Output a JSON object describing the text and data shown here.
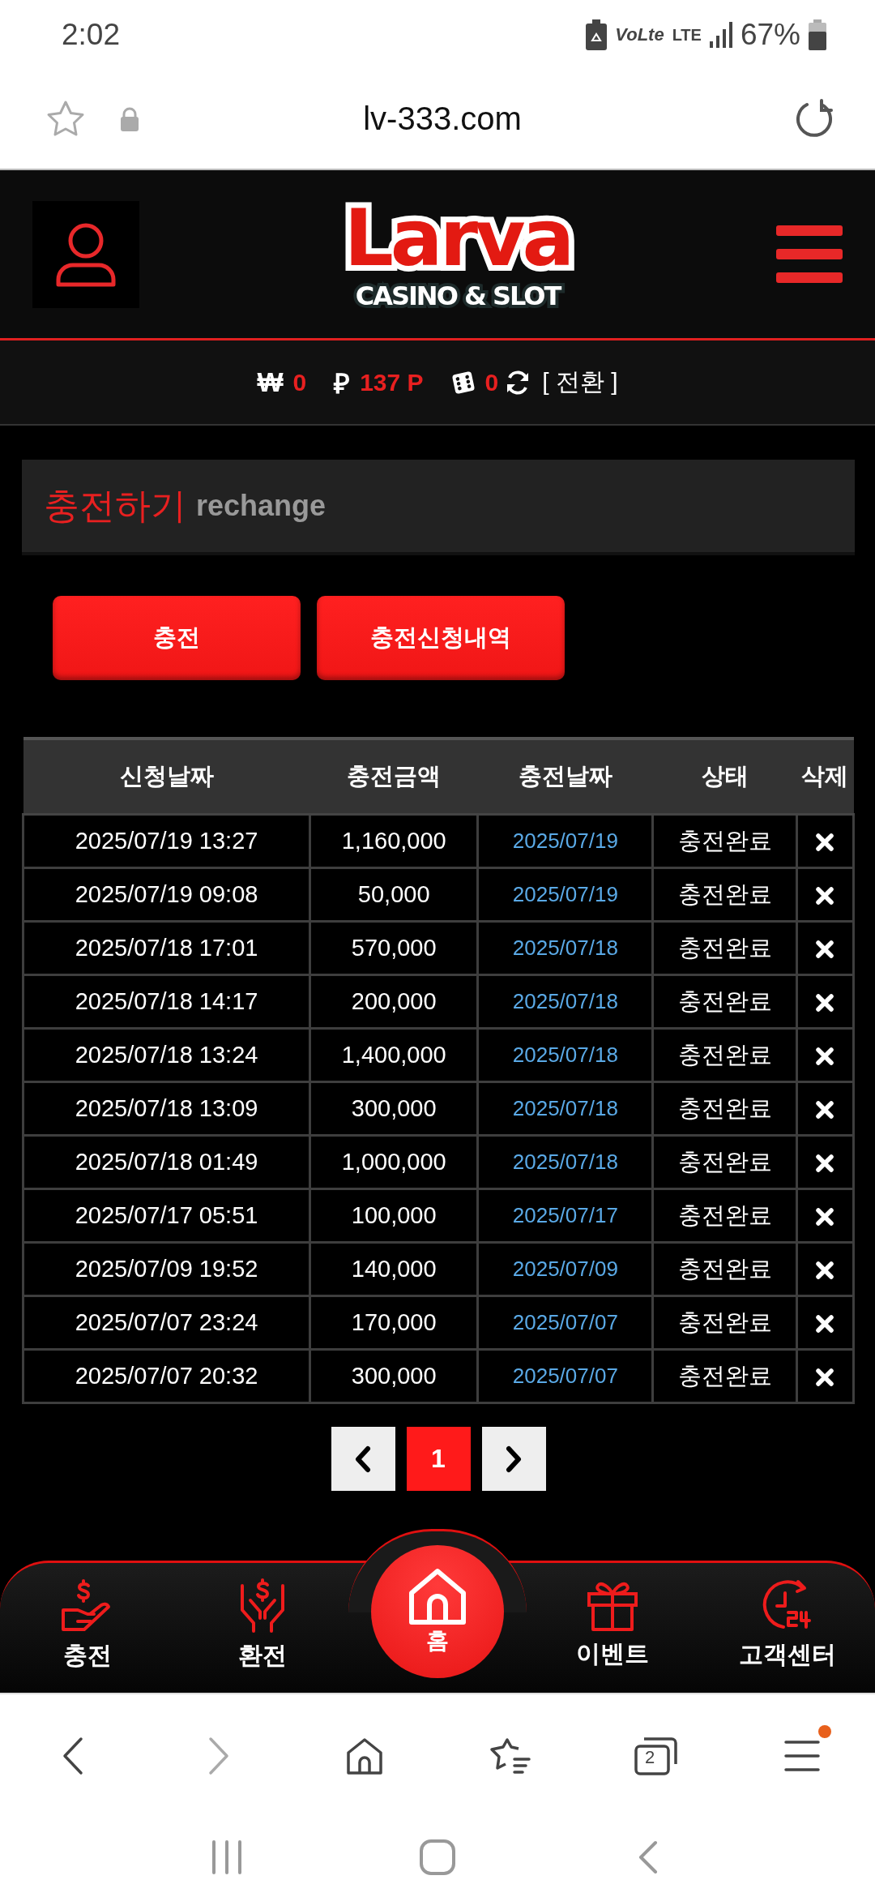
{
  "status_bar": {
    "time": "2:02",
    "volte": "VoLte",
    "network": "LTE",
    "battery": "67%"
  },
  "browser": {
    "url": "lv-333.com",
    "tabs_count": "2",
    "menu_badge": true
  },
  "logo": {
    "title": "Larva",
    "subtitle": "CASINO & SLOT"
  },
  "balance": [
    {
      "symbol": "₩",
      "kind": "won",
      "value": "0"
    },
    {
      "symbol": "₽",
      "kind": "point",
      "value": "137 P"
    },
    {
      "kind": "dice",
      "value": "0"
    }
  ],
  "convert_link": "[ 전환 ]",
  "page_title": {
    "korean": "충전하기",
    "english": "rechange"
  },
  "buttons": [
    {
      "label": "충전"
    },
    {
      "label": "충전신청내역"
    }
  ],
  "table": {
    "columns": [
      "신청날짜",
      "충전금액",
      "충전날짜",
      "상태",
      "삭제"
    ],
    "rows": [
      {
        "requested": "2025/07/19 13:27",
        "amount": "1,160,000",
        "charged": "2025/07/19",
        "status": "충전완료"
      },
      {
        "requested": "2025/07/19 09:08",
        "amount": "50,000",
        "charged": "2025/07/19",
        "status": "충전완료"
      },
      {
        "requested": "2025/07/18 17:01",
        "amount": "570,000",
        "charged": "2025/07/18",
        "status": "충전완료"
      },
      {
        "requested": "2025/07/18 14:17",
        "amount": "200,000",
        "charged": "2025/07/18",
        "status": "충전완료"
      },
      {
        "requested": "2025/07/18 13:24",
        "amount": "1,400,000",
        "charged": "2025/07/18",
        "status": "충전완료"
      },
      {
        "requested": "2025/07/18 13:09",
        "amount": "300,000",
        "charged": "2025/07/18",
        "status": "충전완료"
      },
      {
        "requested": "2025/07/18 01:49",
        "amount": "1,000,000",
        "charged": "2025/07/18",
        "status": "충전완료"
      },
      {
        "requested": "2025/07/17 05:51",
        "amount": "100,000",
        "charged": "2025/07/17",
        "status": "충전완료"
      },
      {
        "requested": "2025/07/09 19:52",
        "amount": "140,000",
        "charged": "2025/07/09",
        "status": "충전완료"
      },
      {
        "requested": "2025/07/07 23:24",
        "amount": "170,000",
        "charged": "2025/07/07",
        "status": "충전완료"
      },
      {
        "requested": "2025/07/07 20:32",
        "amount": "300,000",
        "charged": "2025/07/07",
        "status": "충전완료"
      }
    ]
  },
  "pagination": {
    "pages": [
      {
        "label": "1",
        "selected": true
      }
    ]
  },
  "bottom_nav": [
    {
      "kind": "charge",
      "label": "충전"
    },
    {
      "kind": "exchange",
      "label": "환전"
    },
    {
      "kind": "home",
      "label": "홈"
    },
    {
      "kind": "event",
      "label": "이벤트"
    },
    {
      "kind": "support",
      "label": "고객센터"
    }
  ]
}
